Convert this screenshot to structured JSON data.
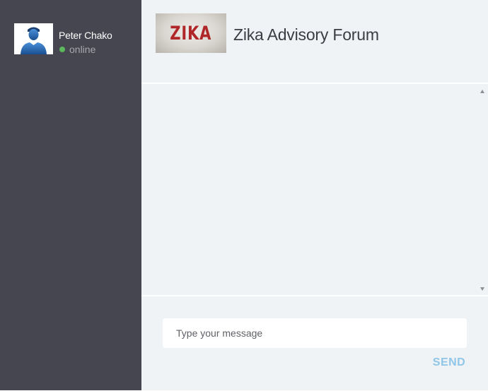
{
  "user": {
    "name": "Peter Chako",
    "status": "online",
    "status_color": "#5cb85c",
    "avatar_icon": "user-avatar-icon"
  },
  "forum": {
    "logo_text": "ZIKA",
    "title": "Zika Advisory Forum"
  },
  "composer": {
    "placeholder": "Type your message",
    "value": "",
    "send_label": "SEND"
  },
  "colors": {
    "sidebar_bg": "#45464f",
    "main_bg": "#f0f3f6",
    "send_accent": "#8fc6e8",
    "logo_text": "#b0272a"
  }
}
